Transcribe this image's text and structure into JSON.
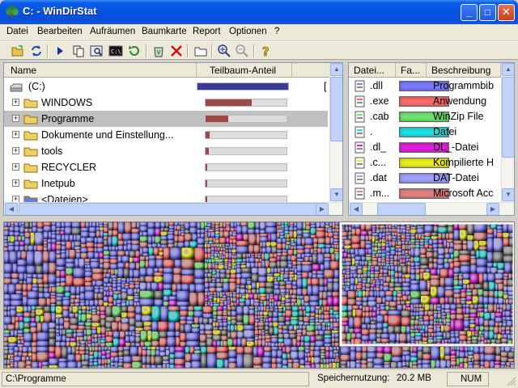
{
  "window": {
    "title": "C: - WinDirStat",
    "minimize": "_",
    "maximize": "□",
    "close": "✕"
  },
  "menu": [
    "Datei",
    "Bearbeiten",
    "Aufräumen",
    "Baumkarte",
    "Report",
    "Optionen",
    "?"
  ],
  "tree": {
    "columns": {
      "name": "Name",
      "subtree": "Teilbaum-Anteil"
    },
    "rows": [
      {
        "label": "(C:)",
        "bar": 1.0,
        "kind": "drive",
        "trail": "["
      },
      {
        "label": "WINDOWS",
        "bar": 0.57,
        "kind": "folder"
      },
      {
        "label": "Programme",
        "bar": 0.28,
        "kind": "folder",
        "selected": true
      },
      {
        "label": "Dokumente und Einstellung...",
        "bar": 0.05,
        "kind": "folder"
      },
      {
        "label": "tools",
        "bar": 0.04,
        "kind": "folder"
      },
      {
        "label": "RECYCLER",
        "bar": 0.02,
        "kind": "folder"
      },
      {
        "label": "Inetpub",
        "bar": 0.005,
        "kind": "folder"
      },
      {
        "label": "<Dateien>",
        "bar": 0.003,
        "kind": "files"
      }
    ]
  },
  "ext_list": {
    "columns": {
      "ext": "Datei...",
      "color": "Fa...",
      "desc": "Beschreibung"
    },
    "rows": [
      {
        "ext": ".dll",
        "color": "#7b7bff",
        "desc": "Programmbib",
        "icon": "dll-icon"
      },
      {
        "ext": ".exe",
        "color": "#ff6b6b",
        "desc": "Anwendung",
        "icon": "exe-icon"
      },
      {
        "ext": ".cab",
        "color": "#6fe46f",
        "desc": "WinZip File",
        "icon": "cab-icon"
      },
      {
        "ext": ".",
        "color": "#20e0e0",
        "desc": "Datei",
        "icon": "file-icon"
      },
      {
        "ext": ".dl_",
        "color": "#e020e0",
        "desc": "DL_-Datei",
        "icon": "file-icon"
      },
      {
        "ext": ".c...",
        "color": "#ecec20",
        "desc": "Kompilierte H",
        "icon": "chm-icon"
      },
      {
        "ext": ".dat",
        "color": "#a0a0ff",
        "desc": "DAT-Datei",
        "icon": "file-icon"
      },
      {
        "ext": ".m...",
        "color": "#e08080",
        "desc": "Microsoft Acc",
        "icon": "access-icon"
      }
    ]
  },
  "status": {
    "path": "C:\\Programme",
    "memory_label": "Speichernutzung:",
    "memory_value": "20.2 MB",
    "num": "NUM"
  }
}
